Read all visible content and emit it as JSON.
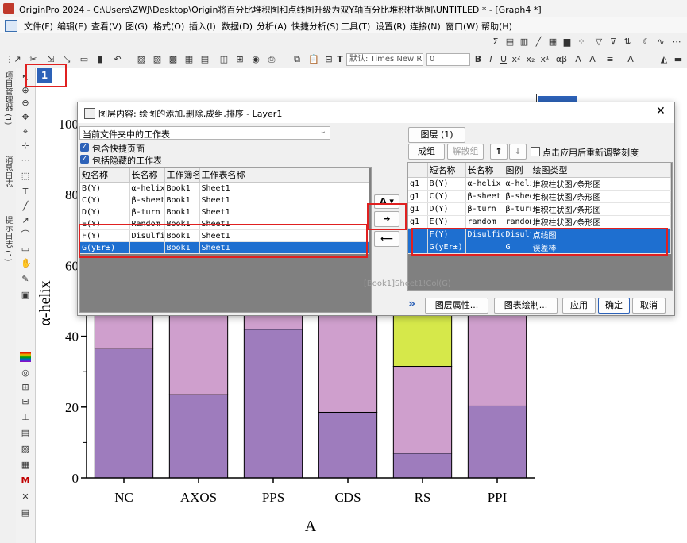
{
  "window": {
    "title": "OriginPro 2024 - C:\\Users\\ZWJ\\Desktop\\Origin将百分比堆积图和点线图升级为双Y轴百分比堆积柱状图\\UNTITLED * - [Graph4 *]"
  },
  "menu": [
    "文件(F)",
    "编辑(E)",
    "查看(V)",
    "图(G)",
    "格式(O)",
    "插入(I)",
    "数据(D)",
    "分析(A)",
    "快捷分析(S)",
    "工具(T)",
    "设置(R)",
    "连接(N)",
    "窗口(W)",
    "帮助(H)"
  ],
  "toolbar": {
    "font_name": "默认: Times New R",
    "font_size": "0"
  },
  "left_tabs": [
    "项目管理器 (1)",
    "消息日志",
    "提示日志 (1)"
  ],
  "graph": {
    "layer_number": "1",
    "y_axis_label": "α-helix",
    "x_axis_label": "A"
  },
  "chart_data": {
    "type": "bar",
    "stacked": true,
    "categories": [
      "NC",
      "AXOS",
      "PPS",
      "CDS",
      "RS",
      "PPI"
    ],
    "xlabel": "A",
    "ylabel": "α-helix",
    "ylim": [
      0,
      100
    ],
    "yticks": [
      "0",
      "20",
      "40",
      "60",
      "80",
      "100"
    ],
    "series": [
      {
        "values": [
          36.5,
          23.5,
          42.0,
          18.5,
          7.0,
          20.3
        ],
        "color": "#9e7cbd"
      },
      {
        "values": [
          63.5,
          76.5,
          58.0,
          81.5,
          24.5,
          79.7
        ],
        "color": "#cf9fcd"
      },
      {
        "values": [
          0,
          0,
          0,
          0,
          68.5,
          0
        ],
        "color": "#d6e84a"
      }
    ]
  },
  "dialog": {
    "title": "图层内容: 绘图的添加,删除,成组,排序 - Layer1",
    "source_dropdown": "当前文件夹中的工作表",
    "check_shortcut": "包含快捷页面",
    "check_hidden": "包括隐藏的工作表",
    "left_headers": [
      "短名称",
      "长名称",
      "工作簿名",
      "工作表名称"
    ],
    "left_rows": [
      [
        "B(Y)",
        "α-helix",
        "Book1",
        "Sheet1"
      ],
      [
        "C(Y)",
        "β-sheet",
        "Book1",
        "Sheet1"
      ],
      [
        "D(Y)",
        "β-turn",
        "Book1",
        "Sheet1"
      ],
      [
        "E(Y)",
        "Random",
        "Book1",
        "Sheet1"
      ],
      [
        "F(Y)",
        "Disulfide",
        "Book1",
        "Sheet1"
      ],
      [
        "G(yEr±)",
        "",
        "Book1",
        "Sheet1"
      ]
    ],
    "layer_button": "图层 (1)",
    "group_button": "成组",
    "ungroup_button": "解散组",
    "rescale_label": "点击应用后重新调整刻度",
    "right_headers": [
      "",
      "短名称",
      "长名称",
      "图例",
      "绘图类型"
    ],
    "right_rows": [
      [
        "g1",
        "B(Y)",
        "α-helix",
        "α-helix",
        "堆积柱状图/条形图"
      ],
      [
        "g1",
        "C(Y)",
        "β-sheet",
        "β-sheet",
        "堆积柱状图/条形图"
      ],
      [
        "g1",
        "D(Y)",
        "β-turn",
        "β-turn",
        "堆积柱状图/条形图"
      ],
      [
        "g1",
        "E(Y)",
        "random",
        "random",
        "堆积柱状图/条形图"
      ],
      [
        "",
        "F(Y)",
        "Disulfide",
        "Disulfide",
        "点线图"
      ],
      [
        "",
        "G(yEr±)",
        "",
        "G",
        "误差棒"
      ]
    ],
    "faded_caption": "[Book1]Sheet1!Col(G)",
    "btn_layer_props": "图层属性...",
    "btn_plot_setup": "图表绘制...",
    "btn_apply": "应用",
    "btn_ok": "确定",
    "btn_cancel": "取消"
  }
}
